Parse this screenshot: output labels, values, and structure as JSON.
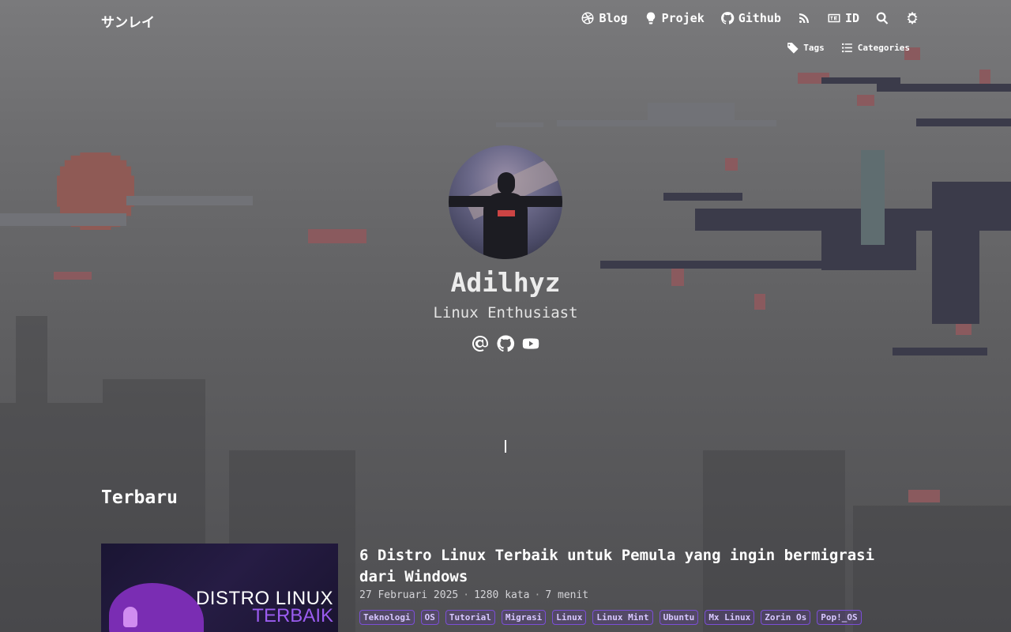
{
  "header": {
    "brand": "サンレイ",
    "nav": [
      {
        "label": "Blog",
        "icon": "dribbble-icon"
      },
      {
        "label": "Projek",
        "icon": "lightbulb-icon"
      },
      {
        "label": "Github",
        "icon": "github-icon"
      },
      {
        "label": "",
        "icon": "rss-icon"
      },
      {
        "label": "ID",
        "icon": "language-icon"
      },
      {
        "label": "",
        "icon": "search-icon"
      },
      {
        "label": "",
        "icon": "theme-toggle-icon"
      }
    ],
    "subnav": [
      {
        "label": "Tags",
        "icon": "tag-icon"
      },
      {
        "label": "Categories",
        "icon": "list-icon"
      }
    ]
  },
  "profile": {
    "name": "Adilhyz",
    "subtitle": "Linux Enthusiast",
    "socials": [
      "email-icon",
      "github-icon",
      "youtube-icon"
    ]
  },
  "latest": {
    "title": "Terbaru",
    "posts": [
      {
        "title": "6 Distro Linux Terbaik untuk Pemula yang ingin bermigrasi dari Windows",
        "date": "27 Februari 2025",
        "words": "1280 kata",
        "read_time": "7 menit",
        "thumb_line1": "DISTRO LINUX",
        "thumb_line2": "TERBAIK",
        "tags": [
          "Teknologi",
          "OS",
          "Tutorial",
          "Migrasi",
          "Linux",
          "Linux Mint",
          "Ubuntu",
          "Mx Linux",
          "Zorin Os",
          "Pop!_OS"
        ]
      }
    ]
  },
  "colors": {
    "accent": "#7b4fd6",
    "background": "#6e6e70",
    "text": "#ffffff"
  }
}
